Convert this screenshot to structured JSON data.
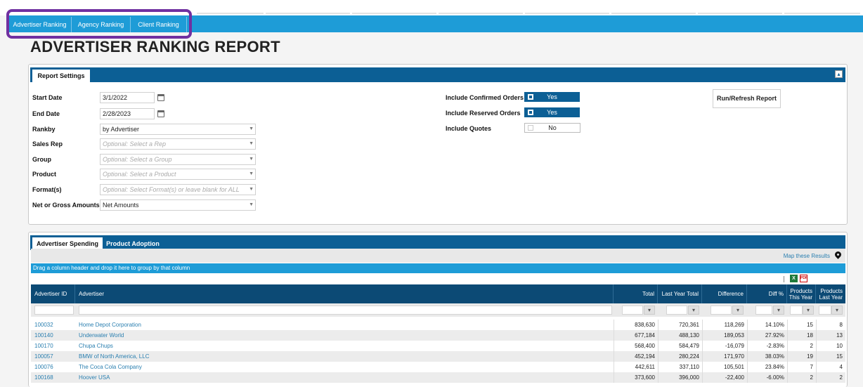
{
  "nav": {
    "tabs": [
      {
        "label": "Advertiser Ranking"
      },
      {
        "label": "Agency Ranking"
      },
      {
        "label": "Client Ranking"
      }
    ]
  },
  "page": {
    "title": "ADVERTISER RANKING REPORT"
  },
  "settings": {
    "tab_label": "Report Settings",
    "start_date_label": "Start Date",
    "start_date": "3/1/2022",
    "end_date_label": "End Date",
    "end_date": "2/28/2023",
    "rankby_label": "Rankby",
    "rankby_value": "by Advertiser",
    "sales_rep_label": "Sales Rep",
    "sales_rep_placeholder": "Optional: Select a Rep",
    "group_label": "Group",
    "group_placeholder": "Optional: Select a Group",
    "product_label": "Product",
    "product_placeholder": "Optional: Select a Product",
    "formats_label": "Format(s)",
    "formats_placeholder": "Optional: Select Format(s) or leave blank for ALL",
    "net_gross_label": "Net or Gross Amounts",
    "net_gross_value": "Net Amounts",
    "include_confirmed_label": "Include Confirmed Orders",
    "include_confirmed_value": "Yes",
    "include_reserved_label": "Include Reserved Orders",
    "include_reserved_value": "Yes",
    "include_quotes_label": "Include Quotes",
    "include_quotes_value": "No",
    "run_button": "Run/Refresh Report"
  },
  "results": {
    "tabs": [
      {
        "label": "Advertiser Spending"
      },
      {
        "label": "Product Adoption"
      }
    ],
    "map_link": "Map these Results",
    "group_hint": "Drag a column header and drop it here to group by that column",
    "excel_icon": "excel-icon",
    "pdf_icon": "pdf-icon",
    "columns": {
      "advertiser_id": "Advertiser ID",
      "advertiser": "Advertiser",
      "total": "Total",
      "last_year_total": "Last Year Total",
      "difference": "Difference",
      "diff_pct": "Diff %",
      "products_this_year": "Products This Year",
      "products_last_year": "Products Last Year"
    },
    "rows": [
      {
        "id": "100032",
        "name": "Home Depot Corporation",
        "total": "838,630",
        "last": "720,361",
        "diff": "118,269",
        "pct": "14.10%",
        "pty": "15",
        "ply": "8"
      },
      {
        "id": "100140",
        "name": "Underwater World",
        "total": "677,184",
        "last": "488,130",
        "diff": "189,053",
        "pct": "27.92%",
        "pty": "18",
        "ply": "13"
      },
      {
        "id": "100170",
        "name": "Chupa Chups",
        "total": "568,400",
        "last": "584,479",
        "diff": "-16,079",
        "pct": "-2.83%",
        "pty": "2",
        "ply": "10"
      },
      {
        "id": "100057",
        "name": "BMW of North America, LLC",
        "total": "452,194",
        "last": "280,224",
        "diff": "171,970",
        "pct": "38.03%",
        "pty": "19",
        "ply": "15"
      },
      {
        "id": "100076",
        "name": "The Coca Cola Company",
        "total": "442,611",
        "last": "337,110",
        "diff": "105,501",
        "pct": "23.84%",
        "pty": "7",
        "ply": "4"
      },
      {
        "id": "100168",
        "name": "Hoover USA",
        "total": "373,600",
        "last": "396,000",
        "diff": "-22,400",
        "pct": "-6.00%",
        "pty": "2",
        "ply": "2"
      }
    ]
  }
}
